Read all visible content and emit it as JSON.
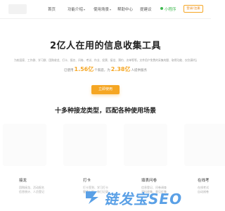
{
  "header": {
    "nav": {
      "home": "首页",
      "tools": "功能介绍",
      "cases": "使用场景",
      "help": "帮助中心",
      "feedback": "提建议",
      "mini_program": "小程序"
    },
    "login_label": "登录/注册"
  },
  "hero": {
    "title": "2亿人在用的信息收集工具",
    "description": "为校园家、工作群、学习群、团购收龙、打卡、报名、问卷、考试、作业、投票、接龙、预约、次单等等，文件用户免费的采集的题、取得功能、仅别满代送收集平台",
    "stats": {
      "prefix": "已使用",
      "users": "1.56亿",
      "middle": "个家庭，为",
      "times": "2.38亿",
      "suffix": "人提供服务"
    },
    "cta_label": "立即使用"
  },
  "section": {
    "title": "十多种接龙类型，匹配各种使用场景"
  },
  "features": [
    {
      "title": "接龙",
      "lines": [
        "团购接龙、活动报名",
        "信息统计、人员登记"
      ]
    },
    {
      "title": "打卡",
      "lines": [
        "打卡签到、学习打卡",
        "健康上报、每日记录"
      ]
    },
    {
      "title": "填表问卷",
      "lines": [
        "信息登记、问卷调查",
        "资料收集、意见征集"
      ]
    },
    {
      "title": "在线考",
      "lines": [
        "在线考试",
        "自动阅卷"
      ]
    }
  ],
  "watermark": {
    "text": "链发宝SEO"
  },
  "colors": {
    "accent": "#f5a623",
    "mini_program": "#3fb950",
    "watermark": "#5aa0e6"
  }
}
